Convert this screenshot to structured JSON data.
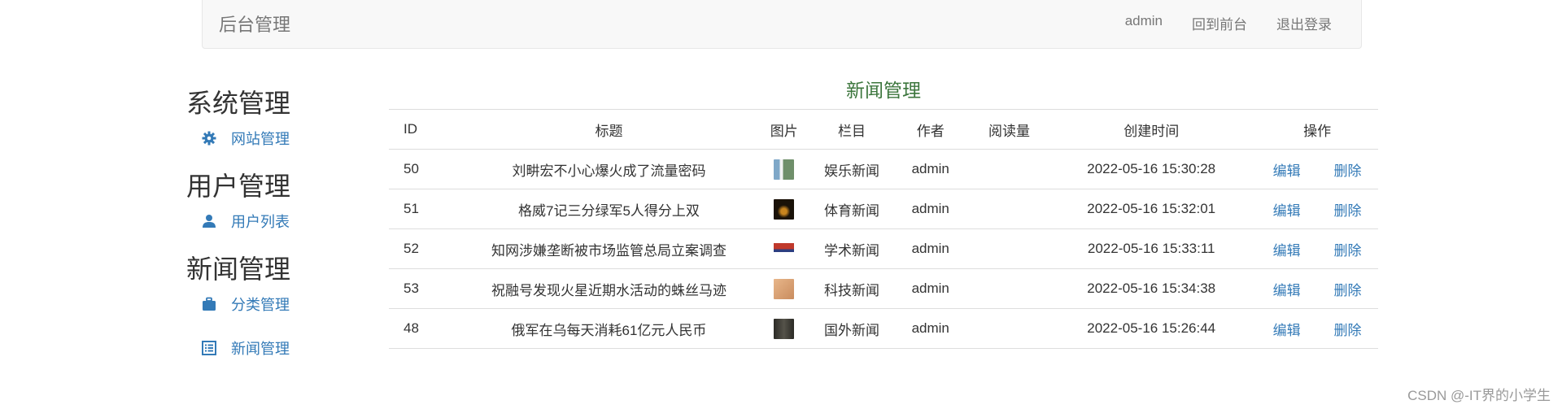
{
  "navbar": {
    "brand": "后台管理",
    "user": "admin",
    "front_link": "回到前台",
    "logout_link": "退出登录"
  },
  "sidebar": {
    "sections": [
      {
        "heading": "系统管理",
        "items": [
          {
            "label": "网站管理",
            "icon": "gear-icon"
          }
        ]
      },
      {
        "heading": "用户管理",
        "items": [
          {
            "label": "用户列表",
            "icon": "user-icon"
          }
        ]
      },
      {
        "heading": "新闻管理",
        "items": [
          {
            "label": "分类管理",
            "icon": "briefcase-icon"
          },
          {
            "label": "新闻管理",
            "icon": "list-icon"
          }
        ]
      }
    ]
  },
  "main": {
    "title": "新闻管理",
    "columns": [
      "ID",
      "标题",
      "图片",
      "栏目",
      "作者",
      "阅读量",
      "创建时间",
      "操作"
    ],
    "rows": [
      {
        "id": "50",
        "title": "刘畊宏不小心爆火成了流量密码",
        "category": "娱乐新闻",
        "author": "admin",
        "reads": "",
        "created": "2022-05-16 15:30:28",
        "thumb_color": "#6f8f6a"
      },
      {
        "id": "51",
        "title": "格威7记三分绿军5人得分上双",
        "category": "体育新闻",
        "author": "admin",
        "reads": "",
        "created": "2022-05-16 15:32:01",
        "thumb_color": "#2a1a0c"
      },
      {
        "id": "52",
        "title": "知网涉嫌垄断被市场监管总局立案调查",
        "category": "学术新闻",
        "author": "admin",
        "reads": "",
        "created": "2022-05-16 15:33:11",
        "thumb_color": "#d9dbe6"
      },
      {
        "id": "53",
        "title": "祝融号发现火星近期水活动的蛛丝马迹",
        "category": "科技新闻",
        "author": "admin",
        "reads": "",
        "created": "2022-05-16 15:34:38",
        "thumb_color": "#d29a6c"
      },
      {
        "id": "48",
        "title": "俄军在乌每天消耗61亿元人民币",
        "category": "国外新闻",
        "author": "admin",
        "reads": "",
        "created": "2022-05-16 15:26:44",
        "thumb_color": "#3b3a34"
      }
    ],
    "edit_label": "编辑",
    "delete_label": "删除"
  },
  "watermark": "CSDN @-IT界的小学生"
}
